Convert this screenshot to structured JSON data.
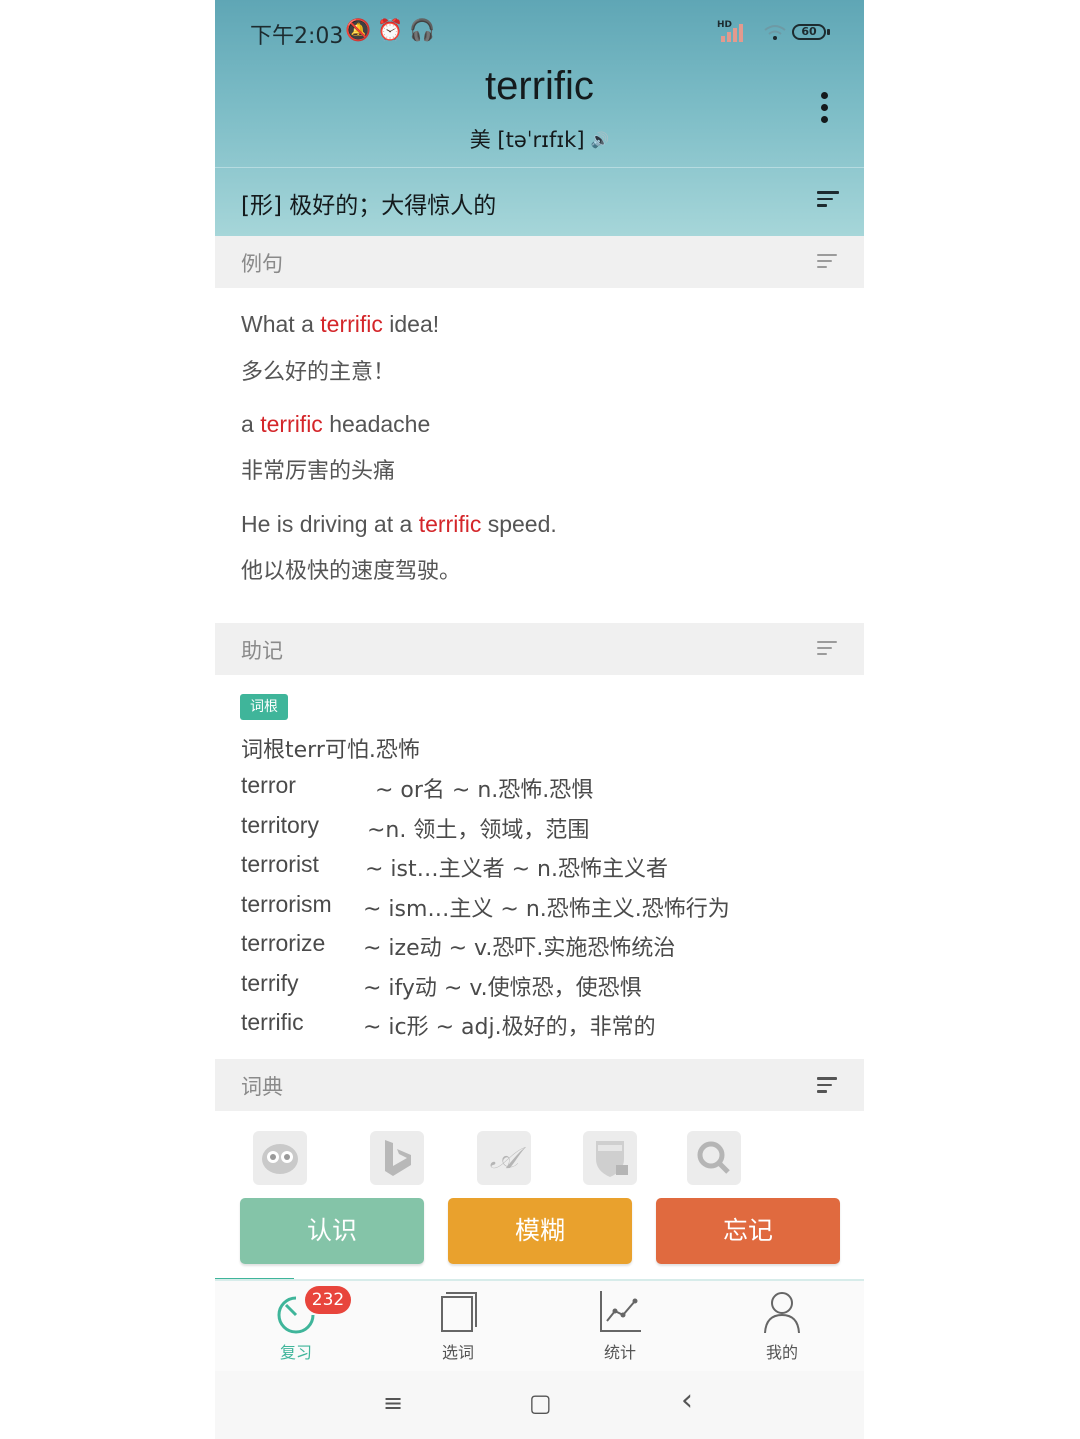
{
  "status_bar": {
    "time": "下午2:03",
    "icons": [
      "silent-bell-icon",
      "alarm-icon",
      "headphones-icon"
    ],
    "hd_label": "HD",
    "battery": "60"
  },
  "word": {
    "headword": "terrific",
    "phonetic": "美 [təˈrɪfɪk]",
    "meaning": "[形] 极好的；大得惊人的"
  },
  "sections": {
    "examples": "例句",
    "mnemonic": "助记",
    "dictionary": "词典"
  },
  "examples": [
    {
      "before": "What a ",
      "highlight": "terrific",
      "after": " idea!",
      "translation": "多么好的主意！"
    },
    {
      "before": "a ",
      "highlight": "terrific",
      "after": " headache",
      "translation": "非常厉害的头痛"
    },
    {
      "before": "He is driving at a ",
      "highlight": "terrific",
      "after": " speed.",
      "translation": "他以极快的速度驾驶。"
    }
  ],
  "mnemonic": {
    "tag": "词根",
    "intro": "词根terr可怕.恐怖",
    "rows": [
      {
        "word": "terror",
        "desc": "~ or名 ~ n.恐怖.恐惧"
      },
      {
        "word": "territory",
        "desc": "~n. 领土，领域，范围"
      },
      {
        "word": "terrorist",
        "desc": "~ ist…主义者 ~ n.恐怖主义者"
      },
      {
        "word": "terrorism",
        "desc": "~ ism…主义 ~ n.恐怖主义.恐怖行为"
      },
      {
        "word": "terrorize",
        "desc": "~ ize动 ~ v.恐吓.实施恐怖统治"
      },
      {
        "word": "terrify",
        "desc": "~ ify动 ~ v.使惊恐，使恐惧"
      },
      {
        "word": "terrific",
        "desc": "~ ic形 ~ adj.极好的，非常的"
      }
    ]
  },
  "dictionary_icons": [
    "owl-dictionary-icon",
    "bing-icon",
    "font-a-icon",
    "cambridge-crest-icon",
    "search-dictionary-icon"
  ],
  "actions": {
    "know": "认识",
    "vague": "模糊",
    "forget": "忘记"
  },
  "colors": {
    "know": "#84c4a8",
    "vague": "#e9a12d",
    "forget": "#e06a3f",
    "accent": "#3fb59a",
    "highlight": "#d4262a"
  },
  "tabs": [
    {
      "label": "复习",
      "icon": "review-timer-icon",
      "badge": "232",
      "active": true
    },
    {
      "label": "选词",
      "icon": "book-icon",
      "active": false
    },
    {
      "label": "统计",
      "icon": "chart-icon",
      "active": false
    },
    {
      "label": "我的",
      "icon": "user-icon",
      "active": false
    }
  ],
  "system_nav": {
    "menu": "≡",
    "home": "▢",
    "back": "‹"
  }
}
